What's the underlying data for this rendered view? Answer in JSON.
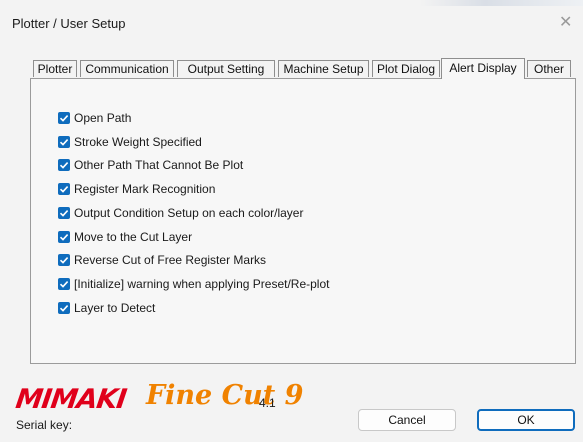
{
  "window": {
    "title": "Plotter / User Setup",
    "close_glyph": "✕"
  },
  "tabs": [
    {
      "label": "Plotter",
      "active": false
    },
    {
      "label": "Communication",
      "active": false
    },
    {
      "label": "Output Setting",
      "active": false
    },
    {
      "label": "Machine Setup",
      "active": false
    },
    {
      "label": "Plot Dialog",
      "active": false
    },
    {
      "label": "Alert Display",
      "active": true
    },
    {
      "label": "Other",
      "active": false
    }
  ],
  "alerts": [
    {
      "label": "Open Path",
      "checked": true
    },
    {
      "label": "Stroke Weight Specified",
      "checked": true
    },
    {
      "label": "Other Path That Cannot Be Plot",
      "checked": true
    },
    {
      "label": "Register Mark Recognition",
      "checked": true
    },
    {
      "label": "Output Condition Setup on each color/layer",
      "checked": true
    },
    {
      "label": "Move to the Cut Layer",
      "checked": true
    },
    {
      "label": "Reverse Cut of Free Register Marks",
      "checked": true
    },
    {
      "label": "[Initialize] warning when applying Preset/Re-plot",
      "checked": true
    },
    {
      "label": "Layer to Detect",
      "checked": true
    }
  ],
  "branding": {
    "mimaki": "MIMAKI",
    "finecut": "Fine Cut 9",
    "version": "4.1"
  },
  "serial_label": "Serial key:",
  "buttons": {
    "cancel": "Cancel",
    "ok": "OK"
  },
  "colors": {
    "accent": "#0f6cbd",
    "mimaki_red": "#e0001b",
    "finecut_orange": "#f08200"
  }
}
